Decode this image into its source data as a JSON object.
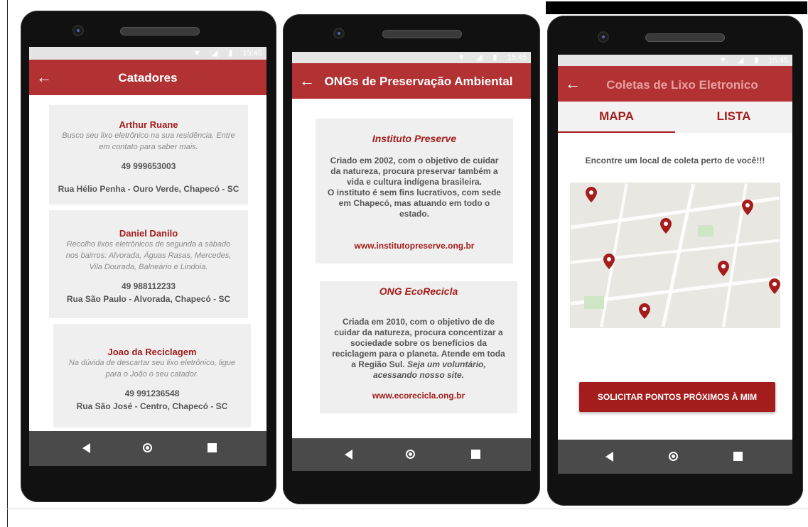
{
  "status": {
    "time": "15:45"
  },
  "screens": {
    "catadores": {
      "title": "Catadores",
      "cards": [
        {
          "name": "Arthur Ruane",
          "desc1": "Busco seu lixo eletrônico na sua residência. Entre",
          "desc2": "em contato para saber mais.",
          "phone": "49 999653003",
          "address": "Rua Hélio Penha - Ouro Verde, Chapecó - SC"
        },
        {
          "name": "Daniel Danilo",
          "desc1": "Recolho lixos eletrônicos de segunda a sábado",
          "desc2": "nos bairros: Alvorada, Águas Rasas, Mercedes,",
          "desc3": "Vila Dourada, Balneário e Lindoia.",
          "phone": "49 988112233",
          "address": "Rua São Paulo - Alvorada, Chapecó - SC"
        },
        {
          "name": "Joao da Reciclagem",
          "desc1": "Na dúvida de descartar seu lixo eletrônico, ligue",
          "desc2": "para o João o seu catador.",
          "phone": "49 991236548",
          "address": "Rua São José - Centro, Chapecó - SC"
        }
      ]
    },
    "ongs": {
      "title": "ONGs de Preservação Ambiental",
      "cards": [
        {
          "name": "Instituto Preserve",
          "lines": [
            "Criado em 2002, com o objetivo de cuidar",
            "da natureza, procura preservar também a",
            "vida e cultura indígena brasileira.",
            "O instituto é sem fins lucrativos, com sede",
            "em Chapecó, mas atuando em todo o",
            "estado."
          ],
          "link": "www.institutopreserve.ong.br"
        },
        {
          "name": "ONG EcoRecicla",
          "lines": [
            "Criada em 2010, com o objetivo de  de",
            "cuidar da natureza, procura concentizar a",
            "sociedade sobre os benefícios da",
            "reciclagem para o planeta.  Atende em toda",
            "a Região Sul."
          ],
          "italic1": "Seja um voluntário,",
          "italic2": "acessando nosso site.",
          "link": "www.ecorecicla.ong.br"
        }
      ]
    },
    "coletas": {
      "title": "Coletas de Lixo Eletronico",
      "tabs": [
        "MAPA",
        "LISTA"
      ],
      "prompt": "Encontre um local de coleta perto de você!!!",
      "button": "SOLICITAR PONTOS PRÓXIMOS À MIM"
    }
  },
  "colors": {
    "accent": "#b23234",
    "link": "#a51c1c",
    "card_bg": "#efefef",
    "navbar": "#4a4a4a"
  }
}
